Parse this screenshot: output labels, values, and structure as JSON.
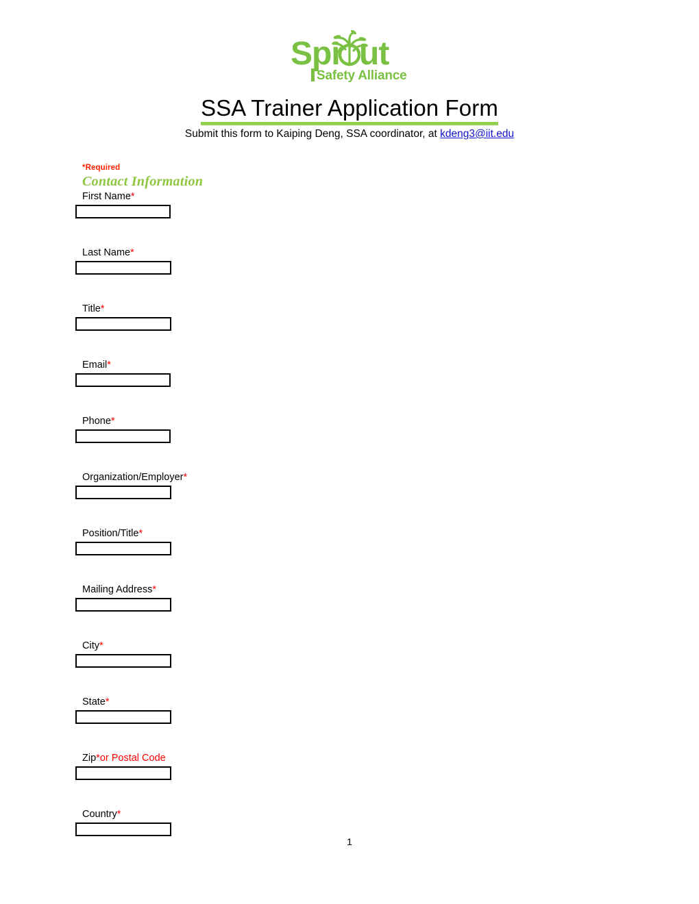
{
  "document": {
    "title": "SSA Trainer Application Form",
    "subtitle_prefix": "Submit this form to Kaiping Deng, SSA coordinator, at ",
    "contact_email": "kdeng3@iit.edu",
    "page_number": "1"
  },
  "logo": {
    "word_mark": "Sprout",
    "tagline": "Safety Alliance",
    "icon_name": "sprout-plant-icon",
    "color": "#7AC143"
  },
  "colors": {
    "title_underline": "#92D050",
    "section_heading": "#8DC63F",
    "required_red": "#FF0000",
    "link_blue": "#1111CC"
  },
  "form": {
    "required_note": "*Required",
    "section_heading": "Contact Information",
    "fields": [
      {
        "label": "First Name",
        "star": "*",
        "value": "",
        "placeholder": ""
      },
      {
        "label": "Last Name",
        "star": "*",
        "value": "",
        "placeholder": ""
      },
      {
        "label": "Title",
        "star": "*",
        "value": "",
        "placeholder": ""
      },
      {
        "label": "Email",
        "star": "*",
        "value": "",
        "placeholder": ""
      },
      {
        "label": "Phone",
        "star": "*",
        "value": "",
        "placeholder": ""
      },
      {
        "label": "Organization/Employer",
        "star": "*",
        "value": "",
        "placeholder": ""
      },
      {
        "label": "Position/Title",
        "star": "*",
        "value": "",
        "placeholder": ""
      },
      {
        "label": "Mailing Address",
        "star": "*",
        "value": "",
        "placeholder": ""
      },
      {
        "label": "City",
        "star": "*",
        "value": "",
        "placeholder": ""
      },
      {
        "label": "State",
        "star": "*",
        "value": "",
        "placeholder": ""
      },
      {
        "label": "Zip",
        "star": "*",
        "suffix_red": "or Postal Code",
        "value": "",
        "placeholder": ""
      },
      {
        "label": "Country",
        "star": "*",
        "value": "",
        "placeholder": ""
      }
    ]
  }
}
